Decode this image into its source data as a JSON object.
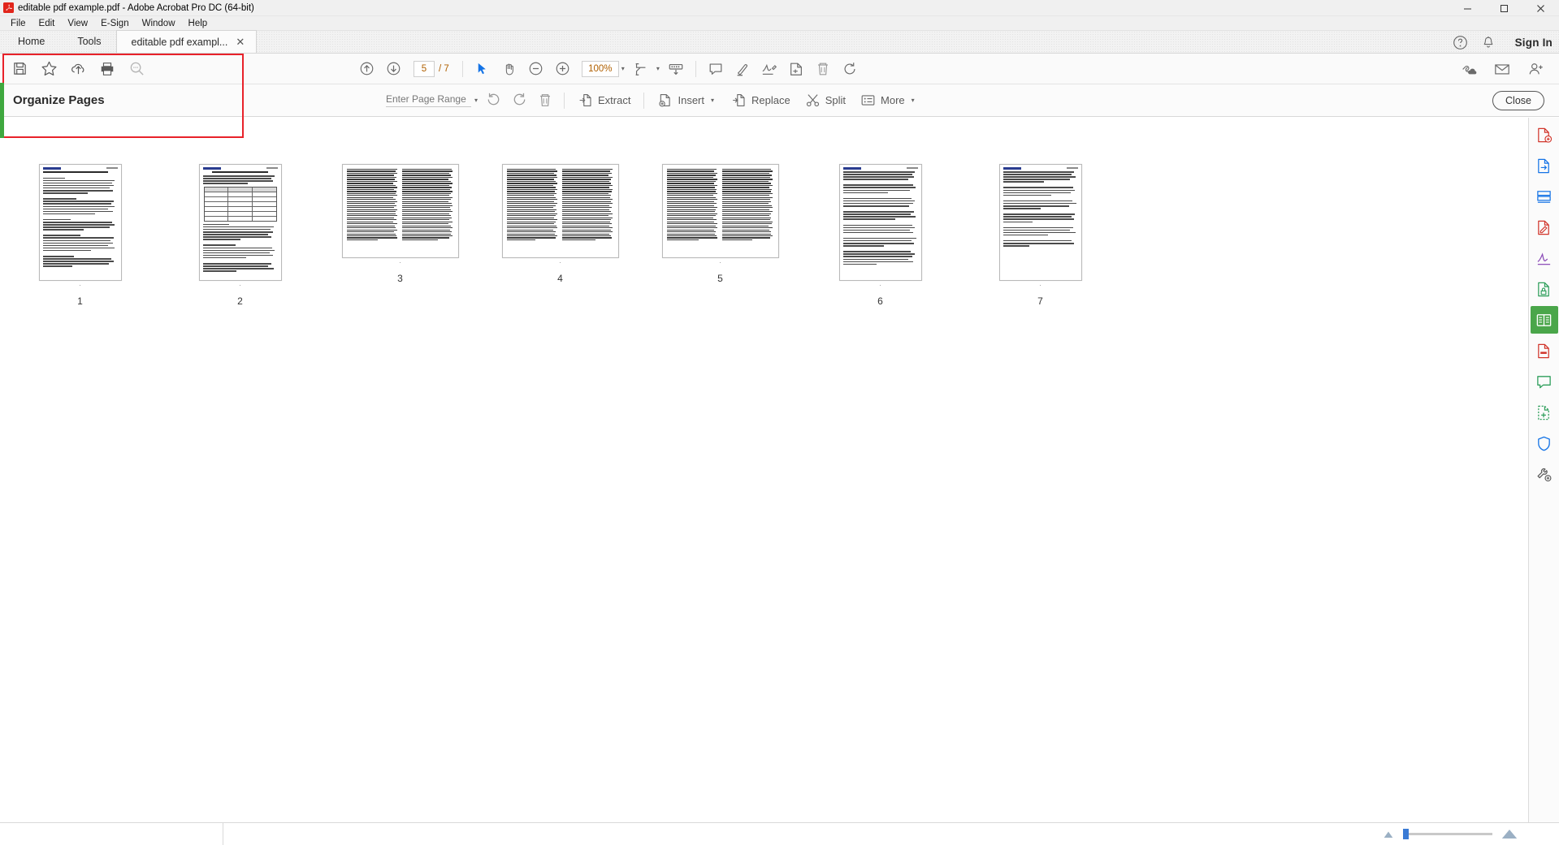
{
  "window": {
    "title": "editable pdf example.pdf - Adobe Acrobat Pro DC (64-bit)",
    "minimize": "–",
    "maximize": "❐",
    "close": "✕"
  },
  "menubar": {
    "items": [
      "File",
      "Edit",
      "View",
      "E-Sign",
      "Window",
      "Help"
    ]
  },
  "tabbar": {
    "home": "Home",
    "tools": "Tools",
    "document_tab": "editable pdf exampl...",
    "document_tab_close": "✕",
    "sign_in": "Sign In"
  },
  "toolbar": {
    "left_icons": [
      "save-icon",
      "star-icon",
      "upload-cloud-icon",
      "print-icon",
      "search-icon"
    ],
    "page_current": "5",
    "page_total": "/ 7",
    "zoom_level": "100%",
    "caret": "▾",
    "center_icons": [
      "previous-page-icon",
      "next-page-icon",
      "select-tool-icon",
      "hand-tool-icon",
      "zoom-out-icon",
      "zoom-in-icon",
      "fit-page-icon",
      "scroll-mode-icon",
      "comment-icon",
      "highlight-icon",
      "signature-icon",
      "stamp-icon",
      "delete-icon",
      "rotate-icon"
    ],
    "right_icons": [
      "link-cloud-icon",
      "email-icon",
      "share-person-icon"
    ]
  },
  "organize_toolbar": {
    "title": "Organize Pages",
    "page_range_placeholder": "Enter Page Range",
    "caret": "▾",
    "rotate_ccw": "rotate-counterclockwise-icon",
    "rotate_cw": "rotate-clockwise-icon",
    "delete": "delete-pages-icon",
    "buttons": [
      {
        "label": "Extract",
        "icon": "extract-icon",
        "has_caret": false
      },
      {
        "label": "Insert",
        "icon": "insert-icon",
        "has_caret": true
      },
      {
        "label": "Replace",
        "icon": "replace-icon",
        "has_caret": false
      },
      {
        "label": "Split",
        "icon": "split-icon",
        "has_caret": false
      },
      {
        "label": "More",
        "icon": "more-icon",
        "has_caret": true
      }
    ],
    "close_label": "Close"
  },
  "thumbnails": {
    "pages": [
      {
        "number": "1",
        "layout": "tall",
        "kind": "text-page"
      },
      {
        "number": "2",
        "layout": "tall",
        "kind": "table-page"
      },
      {
        "number": "3",
        "layout": "wide",
        "kind": "two-column"
      },
      {
        "number": "4",
        "layout": "wide",
        "kind": "two-column"
      },
      {
        "number": "5",
        "layout": "wide",
        "kind": "two-column"
      },
      {
        "number": "6",
        "layout": "tall",
        "kind": "text-page"
      },
      {
        "number": "7",
        "layout": "tall",
        "kind": "text-page"
      }
    ]
  },
  "right_rail": {
    "items": [
      {
        "name": "create-pdf-tool",
        "active": false
      },
      {
        "name": "export-pdf-tool",
        "active": false
      },
      {
        "name": "combine-files-tool",
        "active": false
      },
      {
        "name": "edit-pdf-tool",
        "active": false
      },
      {
        "name": "fill-sign-tool",
        "active": false
      },
      {
        "name": "protect-tool",
        "active": false
      },
      {
        "name": "organize-pages-tool",
        "active": true
      },
      {
        "name": "redact-tool",
        "active": false
      },
      {
        "name": "comment-tool",
        "active": false
      },
      {
        "name": "stamp-tool",
        "active": false
      },
      {
        "name": "shield-tool",
        "active": false
      },
      {
        "name": "more-tools",
        "active": false
      }
    ]
  },
  "statusbar": {
    "zoom_slider_value": "0"
  },
  "colors": {
    "accent_red": "#e8222a",
    "accent_green": "#4aa64a",
    "toolbar_bg": "#fafafa",
    "page_number_text": "#b06000"
  }
}
